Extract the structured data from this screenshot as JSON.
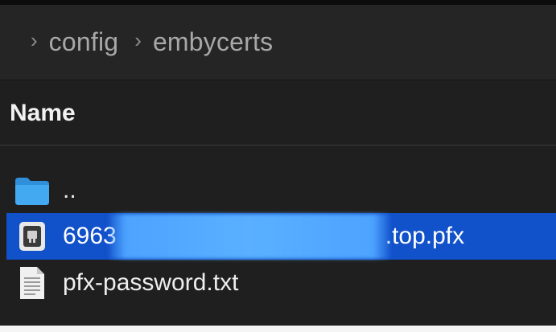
{
  "breadcrumb": {
    "items": [
      {
        "label": "config",
        "icon": "chevron-right-icon"
      },
      {
        "label": "embycerts",
        "icon": "chevron-right-icon"
      }
    ],
    "separator": "›"
  },
  "table": {
    "column_header": "Name"
  },
  "files": [
    {
      "name": "..",
      "type": "folder",
      "icon": "folder-icon",
      "selected": false
    },
    {
      "name_prefix": "6963",
      "name_suffix": ".top.pfx",
      "type": "pfx",
      "icon": "certificate-file-icon",
      "selected": true
    },
    {
      "name": "pfx-password.txt",
      "type": "text",
      "icon": "text-file-icon",
      "selected": false
    }
  ],
  "colors": {
    "background": "#1f1f1f",
    "selection": "#1151c9",
    "folder": "#3fa9f5",
    "redaction": "#5ab0ff"
  }
}
